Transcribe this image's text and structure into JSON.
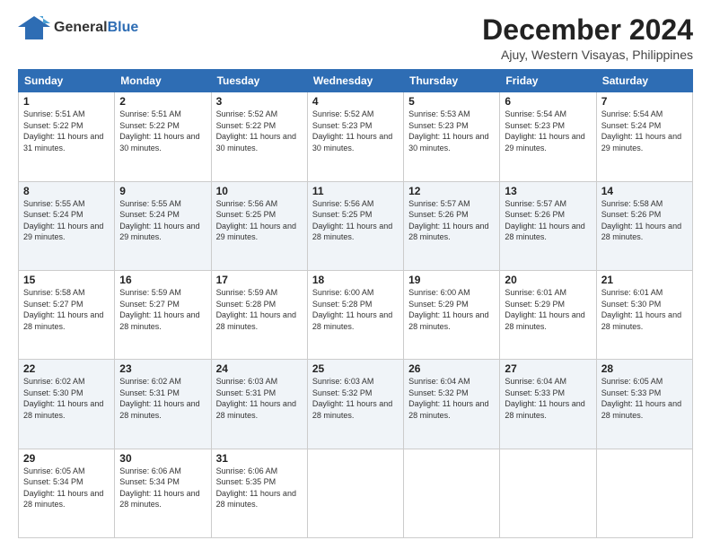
{
  "header": {
    "logo_general": "General",
    "logo_blue": "Blue",
    "main_title": "December 2024",
    "subtitle": "Ajuy, Western Visayas, Philippines"
  },
  "calendar": {
    "days_of_week": [
      "Sunday",
      "Monday",
      "Tuesday",
      "Wednesday",
      "Thursday",
      "Friday",
      "Saturday"
    ],
    "weeks": [
      [
        null,
        {
          "day": "2",
          "sunrise": "5:51 AM",
          "sunset": "5:22 PM",
          "daylight": "11 hours and 30 minutes."
        },
        {
          "day": "3",
          "sunrise": "5:52 AM",
          "sunset": "5:22 PM",
          "daylight": "11 hours and 30 minutes."
        },
        {
          "day": "4",
          "sunrise": "5:52 AM",
          "sunset": "5:23 PM",
          "daylight": "11 hours and 30 minutes."
        },
        {
          "day": "5",
          "sunrise": "5:53 AM",
          "sunset": "5:23 PM",
          "daylight": "11 hours and 30 minutes."
        },
        {
          "day": "6",
          "sunrise": "5:54 AM",
          "sunset": "5:23 PM",
          "daylight": "11 hours and 29 minutes."
        },
        {
          "day": "7",
          "sunrise": "5:54 AM",
          "sunset": "5:24 PM",
          "daylight": "11 hours and 29 minutes."
        }
      ],
      [
        {
          "day": "1",
          "sunrise": "5:51 AM",
          "sunset": "5:22 PM",
          "daylight": "11 hours and 31 minutes."
        },
        {
          "day": "9",
          "sunrise": "5:55 AM",
          "sunset": "5:24 PM",
          "daylight": "11 hours and 29 minutes."
        },
        {
          "day": "10",
          "sunrise": "5:56 AM",
          "sunset": "5:25 PM",
          "daylight": "11 hours and 29 minutes."
        },
        {
          "day": "11",
          "sunrise": "5:56 AM",
          "sunset": "5:25 PM",
          "daylight": "11 hours and 28 minutes."
        },
        {
          "day": "12",
          "sunrise": "5:57 AM",
          "sunset": "5:26 PM",
          "daylight": "11 hours and 28 minutes."
        },
        {
          "day": "13",
          "sunrise": "5:57 AM",
          "sunset": "5:26 PM",
          "daylight": "11 hours and 28 minutes."
        },
        {
          "day": "14",
          "sunrise": "5:58 AM",
          "sunset": "5:26 PM",
          "daylight": "11 hours and 28 minutes."
        }
      ],
      [
        {
          "day": "8",
          "sunrise": "5:55 AM",
          "sunset": "5:24 PM",
          "daylight": "11 hours and 29 minutes."
        },
        {
          "day": "16",
          "sunrise": "5:59 AM",
          "sunset": "5:27 PM",
          "daylight": "11 hours and 28 minutes."
        },
        {
          "day": "17",
          "sunrise": "5:59 AM",
          "sunset": "5:28 PM",
          "daylight": "11 hours and 28 minutes."
        },
        {
          "day": "18",
          "sunrise": "6:00 AM",
          "sunset": "5:28 PM",
          "daylight": "11 hours and 28 minutes."
        },
        {
          "day": "19",
          "sunrise": "6:00 AM",
          "sunset": "5:29 PM",
          "daylight": "11 hours and 28 minutes."
        },
        {
          "day": "20",
          "sunrise": "6:01 AM",
          "sunset": "5:29 PM",
          "daylight": "11 hours and 28 minutes."
        },
        {
          "day": "21",
          "sunrise": "6:01 AM",
          "sunset": "5:30 PM",
          "daylight": "11 hours and 28 minutes."
        }
      ],
      [
        {
          "day": "15",
          "sunrise": "5:58 AM",
          "sunset": "5:27 PM",
          "daylight": "11 hours and 28 minutes."
        },
        {
          "day": "23",
          "sunrise": "6:02 AM",
          "sunset": "5:31 PM",
          "daylight": "11 hours and 28 minutes."
        },
        {
          "day": "24",
          "sunrise": "6:03 AM",
          "sunset": "5:31 PM",
          "daylight": "11 hours and 28 minutes."
        },
        {
          "day": "25",
          "sunrise": "6:03 AM",
          "sunset": "5:32 PM",
          "daylight": "11 hours and 28 minutes."
        },
        {
          "day": "26",
          "sunrise": "6:04 AM",
          "sunset": "5:32 PM",
          "daylight": "11 hours and 28 minutes."
        },
        {
          "day": "27",
          "sunrise": "6:04 AM",
          "sunset": "5:33 PM",
          "daylight": "11 hours and 28 minutes."
        },
        {
          "day": "28",
          "sunrise": "6:05 AM",
          "sunset": "5:33 PM",
          "daylight": "11 hours and 28 minutes."
        }
      ],
      [
        {
          "day": "22",
          "sunrise": "6:02 AM",
          "sunset": "5:30 PM",
          "daylight": "11 hours and 28 minutes."
        },
        {
          "day": "30",
          "sunrise": "6:06 AM",
          "sunset": "5:34 PM",
          "daylight": "11 hours and 28 minutes."
        },
        {
          "day": "31",
          "sunrise": "6:06 AM",
          "sunset": "5:35 PM",
          "daylight": "11 hours and 28 minutes."
        },
        null,
        null,
        null,
        null
      ],
      [
        {
          "day": "29",
          "sunrise": "6:05 AM",
          "sunset": "5:34 PM",
          "daylight": "11 hours and 28 minutes."
        },
        null,
        null,
        null,
        null,
        null,
        null
      ]
    ]
  }
}
